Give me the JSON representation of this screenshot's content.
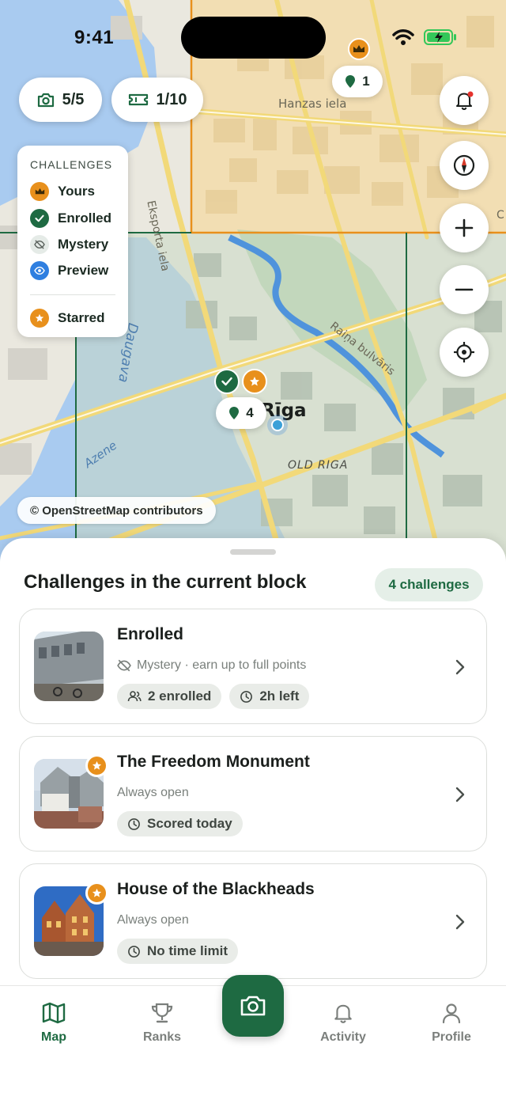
{
  "status_bar": {
    "time": "9:41"
  },
  "map": {
    "photo_counter": "5/5",
    "ticket_counter": "1/10",
    "pin_count_top": "1",
    "pin_count_center": "4",
    "streets": {
      "hanzas": "Hanzas iela",
      "eksporta": "Eksporta iela",
      "raina": "Raiņa bulvāris",
      "daugava": "Daugava",
      "azene": "Azene",
      "riga": "Rīga",
      "old_riga": "OLD RIGA",
      "edge": "C"
    },
    "attribution": "© OpenStreetMap contributors"
  },
  "legend": {
    "title": "CHALLENGES",
    "items": [
      {
        "label": "Yours",
        "color": "#e8901c",
        "icon": "crown-icon"
      },
      {
        "label": "Enrolled",
        "color": "#1e6a42",
        "icon": "check-icon"
      },
      {
        "label": "Mystery",
        "color": "#e5ebe7",
        "icon": "eye-off-icon"
      },
      {
        "label": "Preview",
        "color": "#2f7fe0",
        "icon": "eye-icon"
      }
    ],
    "starred_label": "Starred"
  },
  "sheet": {
    "title": "Challenges in the current block",
    "count_badge": "4 challenges",
    "cards": [
      {
        "title": "Enrolled",
        "subtitle": "Mystery · earn up to full points",
        "chips": [
          "2 enrolled",
          "2h left"
        ],
        "starred": false
      },
      {
        "title": "The Freedom Monument",
        "subtitle": "Always open",
        "chips": [
          "Scored today"
        ],
        "starred": true
      },
      {
        "title": "House of the Blackheads",
        "subtitle": "Always open",
        "chips": [
          "No time limit"
        ],
        "starred": true
      }
    ]
  },
  "tabs": {
    "map": "Map",
    "ranks": "Ranks",
    "activity": "Activity",
    "profile": "Profile"
  },
  "colors": {
    "primary": "#1e6a42",
    "orange": "#e8901c",
    "preview": "#2f7fe0"
  }
}
